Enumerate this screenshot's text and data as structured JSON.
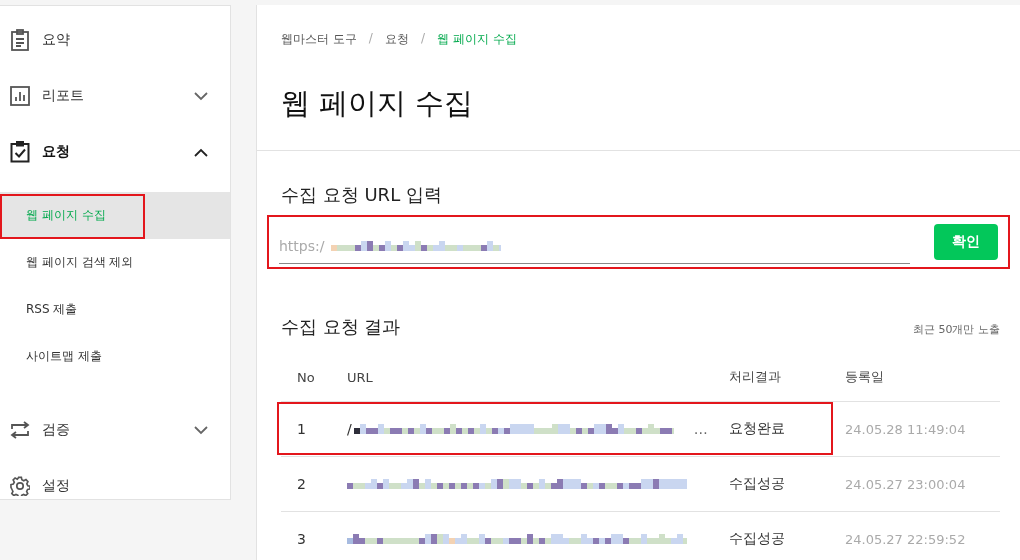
{
  "sidebar": {
    "items": [
      {
        "label": "요약"
      },
      {
        "label": "리포트",
        "expanded": false
      },
      {
        "label": "요청",
        "expanded": true,
        "children": [
          {
            "label": "웹 페이지 수집",
            "selected": true,
            "highlighted": true
          },
          {
            "label": "웹 페이지 검색 제외",
            "selected": false,
            "highlighted": false
          },
          {
            "label": "RSS 제출",
            "selected": false,
            "highlighted": false
          },
          {
            "label": "사이트맵 제출",
            "selected": false,
            "highlighted": false
          }
        ]
      },
      {
        "label": "검증",
        "expanded": false
      },
      {
        "label": "설정"
      }
    ]
  },
  "breadcrumb": [
    {
      "label": "웹마스터 도구",
      "current": false
    },
    {
      "label": "요청",
      "current": false
    },
    {
      "label": "웹 페이지 수집",
      "current": true
    }
  ],
  "breadcrumb_separator": "/",
  "page_title": "웹 페이지 수집",
  "url_form": {
    "title": "수집 요청 URL 입력",
    "value": "https:/",
    "highlighted": true,
    "button": "확인"
  },
  "results": {
    "title": "수집 요청 결과",
    "note": "최근 50개만 노출",
    "columns": [
      "No",
      "URL",
      "처리결과",
      "등록일"
    ],
    "rows": [
      {
        "no": "1",
        "url_start": "/",
        "url_end": "…",
        "status": "요청완료",
        "date": "24.05.28 11:49:04",
        "highlighted": true
      },
      {
        "no": "2",
        "status": "수집성공",
        "date": "24.05.27 23:00:04",
        "highlighted": false
      },
      {
        "no": "3",
        "status": "수집성공",
        "date": "24.05.27 22:59:52",
        "highlighted": false
      }
    ]
  }
}
